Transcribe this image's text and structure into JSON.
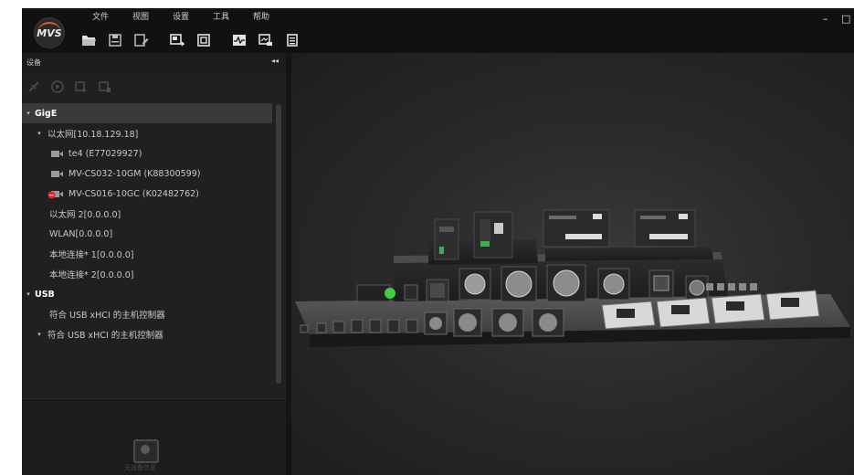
{
  "app": {
    "logo_text": "MVS",
    "colors": {
      "accent": "#e45b2b",
      "background": "#1b1b1d",
      "panel": "#202022",
      "selected_row": "#3a3a3d"
    }
  },
  "menu": [
    "文件",
    "视图",
    "设置",
    "工具",
    "帮助"
  ],
  "toolbar": {
    "icons": [
      "folder-open-icon",
      "save-icon",
      "save-as-icon",
      "export-icon",
      "snapshot-icon",
      "waveform-icon",
      "image-monitor-icon",
      "list-icon"
    ]
  },
  "window_controls": {
    "minimize": "–",
    "maximize": "□"
  },
  "panel": {
    "title": "设备",
    "collapse": "◂◂",
    "tools": [
      "disconnect-icon",
      "play-icon",
      "grab-icon",
      "stop-grab-icon"
    ]
  },
  "tree": [
    {
      "label": "GigE",
      "level": 0,
      "type": "group",
      "expanded": true,
      "selected": true
    },
    {
      "label": "以太网[10.18.129.18]",
      "level": 1,
      "type": "interface",
      "expanded": true
    },
    {
      "label": "te4 (E77029927)",
      "level": 2,
      "type": "camera",
      "status": "idle"
    },
    {
      "label": "MV-CS032-10GM (K88300599)",
      "level": 2,
      "type": "camera",
      "status": "idle"
    },
    {
      "label": "MV-CS016-10GC (K02482762)",
      "level": 2,
      "type": "camera",
      "status": "error"
    },
    {
      "label": "以太网 2[0.0.0.0]",
      "level": 1,
      "type": "interface"
    },
    {
      "label": "WLAN[0.0.0.0]",
      "level": 1,
      "type": "interface"
    },
    {
      "label": "本地连接* 1[0.0.0.0]",
      "level": 1,
      "type": "interface"
    },
    {
      "label": "本地连接* 2[0.0.0.0]",
      "level": 1,
      "type": "interface"
    },
    {
      "label": "USB",
      "level": 0,
      "type": "group",
      "expanded": true
    },
    {
      "label": "符合 USB xHCI 的主机控制器",
      "level": 1,
      "type": "interface"
    },
    {
      "label": "符合 USB xHCI 的主机控制器",
      "level": 1,
      "type": "interface",
      "expanded": true
    }
  ],
  "info": {
    "empty_text": "无设备信息"
  }
}
